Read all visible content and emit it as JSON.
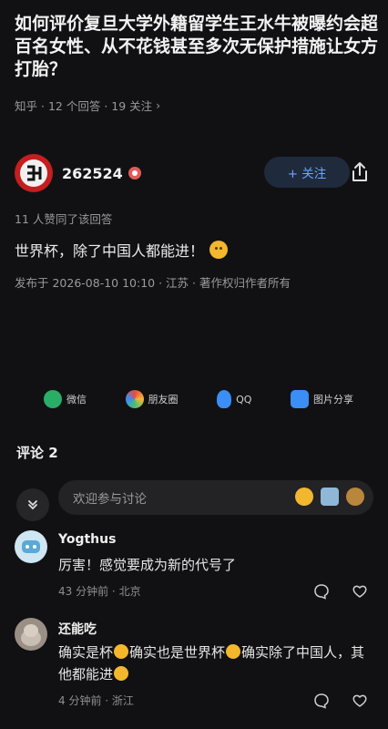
{
  "question": {
    "title": "如何评价复旦大学外籍留学生王水牛被曝约会超百名女性、从不花钱甚至多次无保护措施让女方打胎？",
    "source": "知乎",
    "answers": "· 12 个回答",
    "followers": "· 19 关注",
    "chevron": "›"
  },
  "author": {
    "name": "262524",
    "follow_label": "+ 关注"
  },
  "answer": {
    "upvotes": "11 人赞同了该回答",
    "body": "世界杯，除了中国人都能进！",
    "published": "发布于  2026-08-10 10:10 · 江苏 · 著作权归作者所有"
  },
  "share": [
    {
      "label": "微信",
      "icon": "wechat-icon",
      "color": "#2aae67"
    },
    {
      "label": "朋友圈",
      "icon": "moments-icon",
      "color": "#e9a23b"
    },
    {
      "label": "QQ",
      "icon": "qq-icon",
      "color": "#3a8ef6"
    },
    {
      "label": "图片分享",
      "icon": "image-share-icon",
      "color": "#3a8ef6"
    }
  ],
  "comments_section": {
    "header": "评论  2",
    "input_placeholder": "欢迎参与讨论"
  },
  "comments": [
    {
      "author": "Yogthus",
      "text": "厉害！感觉要成为新的代号了",
      "time": "43 分钟前",
      "location": "北京"
    },
    {
      "author": "还能吃",
      "text_parts": [
        "确实是杯",
        "确实也是世界杯",
        "确实除了中国人，其他都能进"
      ],
      "time": "4 分钟前",
      "location": "浙江"
    }
  ]
}
